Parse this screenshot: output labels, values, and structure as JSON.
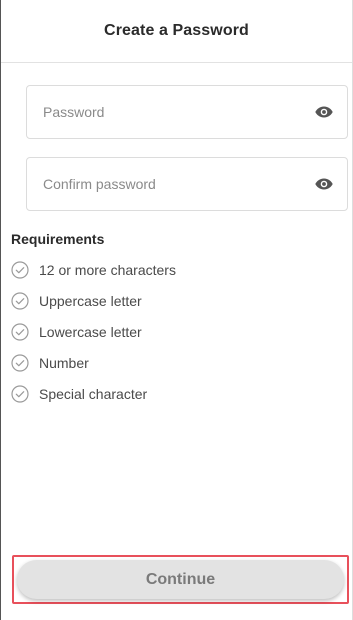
{
  "header": {
    "title": "Create a Password"
  },
  "password_field": {
    "placeholder": "Password",
    "value": "",
    "icon": "eye-icon"
  },
  "confirm_field": {
    "placeholder": "Confirm password",
    "value": "",
    "icon": "eye-icon"
  },
  "requirements": {
    "title": "Requirements",
    "items": [
      {
        "label": "12 or more characters",
        "icon": "check-circle-icon"
      },
      {
        "label": "Uppercase letter",
        "icon": "check-circle-icon"
      },
      {
        "label": "Lowercase letter",
        "icon": "check-circle-icon"
      },
      {
        "label": "Number",
        "icon": "check-circle-icon"
      },
      {
        "label": "Special character",
        "icon": "check-circle-icon"
      }
    ]
  },
  "footer": {
    "continue_label": "Continue"
  },
  "colors": {
    "highlight_border": "#e8505b",
    "button_bg": "#e3e3e3",
    "button_text": "#7a7a7a",
    "check_icon": "#9a9a9a"
  }
}
